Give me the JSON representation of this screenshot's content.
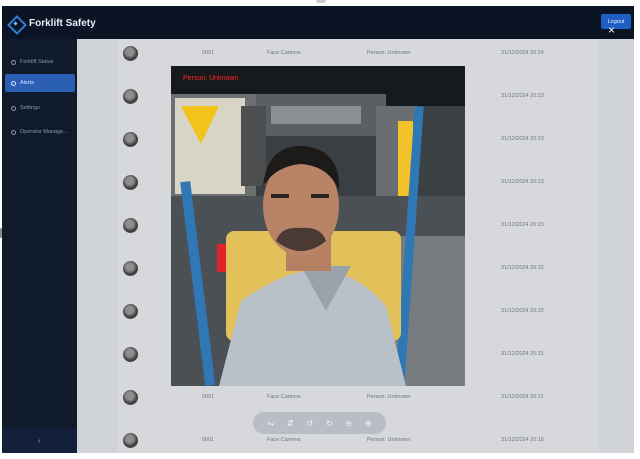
{
  "app": {
    "title": "Forklift Safety",
    "logout_label": "Logout"
  },
  "sidebar": {
    "items": [
      {
        "label": "Forklift Status",
        "active": false
      },
      {
        "label": "Alerts",
        "active": true
      },
      {
        "label": "Settings",
        "active": false
      },
      {
        "label": "Operator Manage...",
        "active": false
      }
    ],
    "collapse_icon": "‹"
  },
  "table": {
    "rows": [
      {
        "id": "0001",
        "type": "Face Camera",
        "person": "Person: Unknown",
        "time": "31/12/2024 20:24"
      },
      {
        "id": "",
        "type": "",
        "person": "",
        "time": "31/12/2024 20:23"
      },
      {
        "id": "",
        "type": "",
        "person": "",
        "time": "31/12/2024 20:23"
      },
      {
        "id": "",
        "type": "",
        "person": "",
        "time": "31/12/2024 20:23"
      },
      {
        "id": "",
        "type": "",
        "person": "",
        "time": "31/12/2024 20:23"
      },
      {
        "id": "",
        "type": "",
        "person": "",
        "time": "31/12/2024 20:22"
      },
      {
        "id": "",
        "type": "",
        "person": "",
        "time": "31/12/2024 20:22"
      },
      {
        "id": "",
        "type": "",
        "person": "",
        "time": "31/12/2024 20:21"
      },
      {
        "id": "0001",
        "type": "Face Camera",
        "person": "Person: Unknown",
        "time": "31/12/2024 20:21"
      },
      {
        "id": "0001",
        "type": "Face Camera",
        "person": "Person: Unknown",
        "time": "31/12/2024 20:18"
      }
    ]
  },
  "viewer": {
    "overlay_label": "Person: Unknown",
    "close_icon": "×",
    "tools": [
      {
        "icon": "flip-horizontal-icon",
        "glyph": "⇋"
      },
      {
        "icon": "flip-vertical-icon",
        "glyph": "⇵"
      },
      {
        "icon": "rotate-left-icon",
        "glyph": "↺"
      },
      {
        "icon": "rotate-right-icon",
        "glyph": "↻"
      },
      {
        "icon": "zoom-out-icon",
        "glyph": "⊖"
      },
      {
        "icon": "zoom-in-icon",
        "glyph": "⊕"
      }
    ]
  },
  "colors": {
    "topbar": "#0b1424",
    "sidebar": "#0f1a2b",
    "active_item": "#2a5fb3",
    "overlay_text": "#ff2424"
  }
}
